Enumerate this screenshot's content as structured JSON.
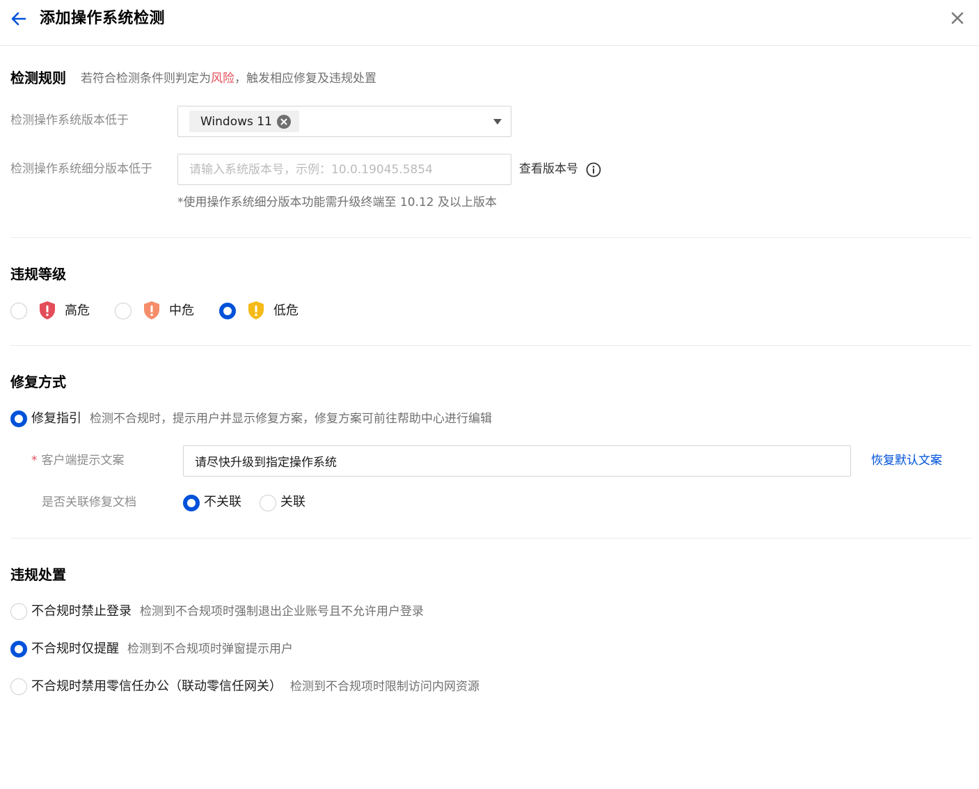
{
  "header": {
    "title": "添加操作系统检测"
  },
  "rules": {
    "title": "检测规则",
    "desc_before": "若符合检测条件则判定为",
    "desc_risk": "风险",
    "desc_after": "，触发相应修复及违规处置",
    "os_version_label": "检测操作系统版本低于",
    "os_version_tag": "Windows 11",
    "sub_version_label": "检测操作系统细分版本低于",
    "sub_version_placeholder": "请输入系统版本号，示例：10.0.19045.5854",
    "sub_version_value": "",
    "view_version_link": "查看版本号",
    "note": "*使用操作系统细分版本功能需升级终端至 10.12 及以上版本"
  },
  "level": {
    "title": "违规等级",
    "options": [
      {
        "label": "高危",
        "color": "#e34d59",
        "checked": false
      },
      {
        "label": "中危",
        "color": "#f58d6b",
        "checked": false
      },
      {
        "label": "低危",
        "color": "#f5ba18",
        "checked": true
      }
    ]
  },
  "repair": {
    "title": "修复方式",
    "method_label": "修复指引",
    "method_desc": "检测不合规时，提示用户并显示修复方案，修复方案可前往帮助中心进行编辑",
    "required_mark": "*",
    "hint_label": "客户端提示文案",
    "hint_value": "请尽快升级到指定操作系统",
    "restore_link": "恢复默认文案",
    "doc_label": "是否关联修复文档",
    "doc_options": [
      {
        "label": "不关联",
        "checked": true
      },
      {
        "label": "关联",
        "checked": false
      }
    ]
  },
  "action": {
    "title": "违规处置",
    "options": [
      {
        "label": "不合规时禁止登录",
        "desc": "检测到不合规项时强制退出企业账号且不允许用户登录",
        "checked": false
      },
      {
        "label": "不合规时仅提醒",
        "desc": "检测到不合规项时弹窗提示用户",
        "checked": true
      },
      {
        "label": "不合规时禁用零信任办公（联动零信任网关）",
        "desc": "检测到不合规项时限制访问内网资源",
        "checked": false
      }
    ]
  },
  "colors": {
    "accent": "#0052d9",
    "risk": "#e34d59"
  }
}
